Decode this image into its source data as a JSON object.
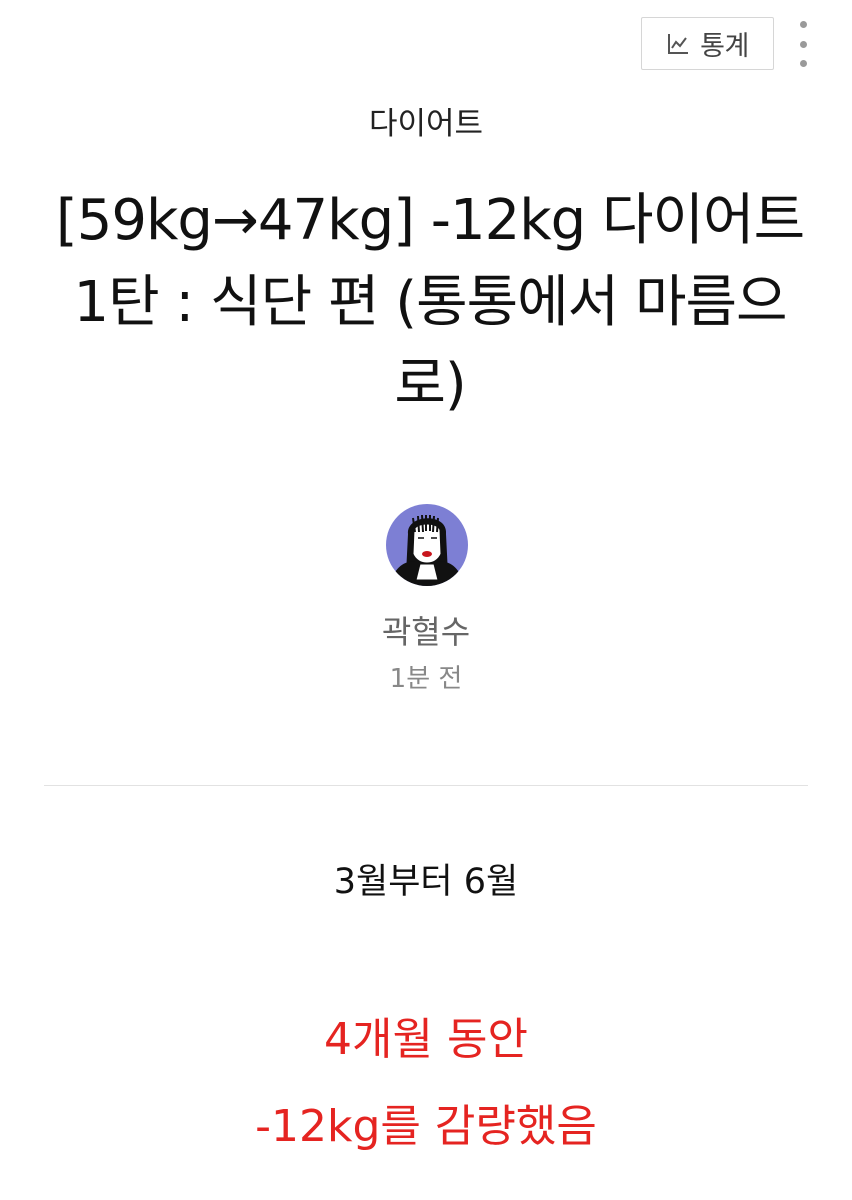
{
  "header": {
    "stats_label": "통계",
    "stats_icon": "chart-line-icon",
    "more_icon": "more-vertical-icon"
  },
  "post": {
    "category": "다이어트",
    "title": "[59kg→47kg] -12kg 다이어트 1탄 : 식단 편 (통통에서 마름으로)",
    "author": {
      "name": "곽혈수",
      "avatar_icon": "avatar-illustration",
      "time": "1분 전"
    },
    "body": {
      "line1": "3월부터 6월",
      "line2": "4개월 동안",
      "line3": "-12kg를 감량했음"
    }
  },
  "colors": {
    "highlight": "#e52421",
    "avatar_bg": "#7d7fd4"
  }
}
